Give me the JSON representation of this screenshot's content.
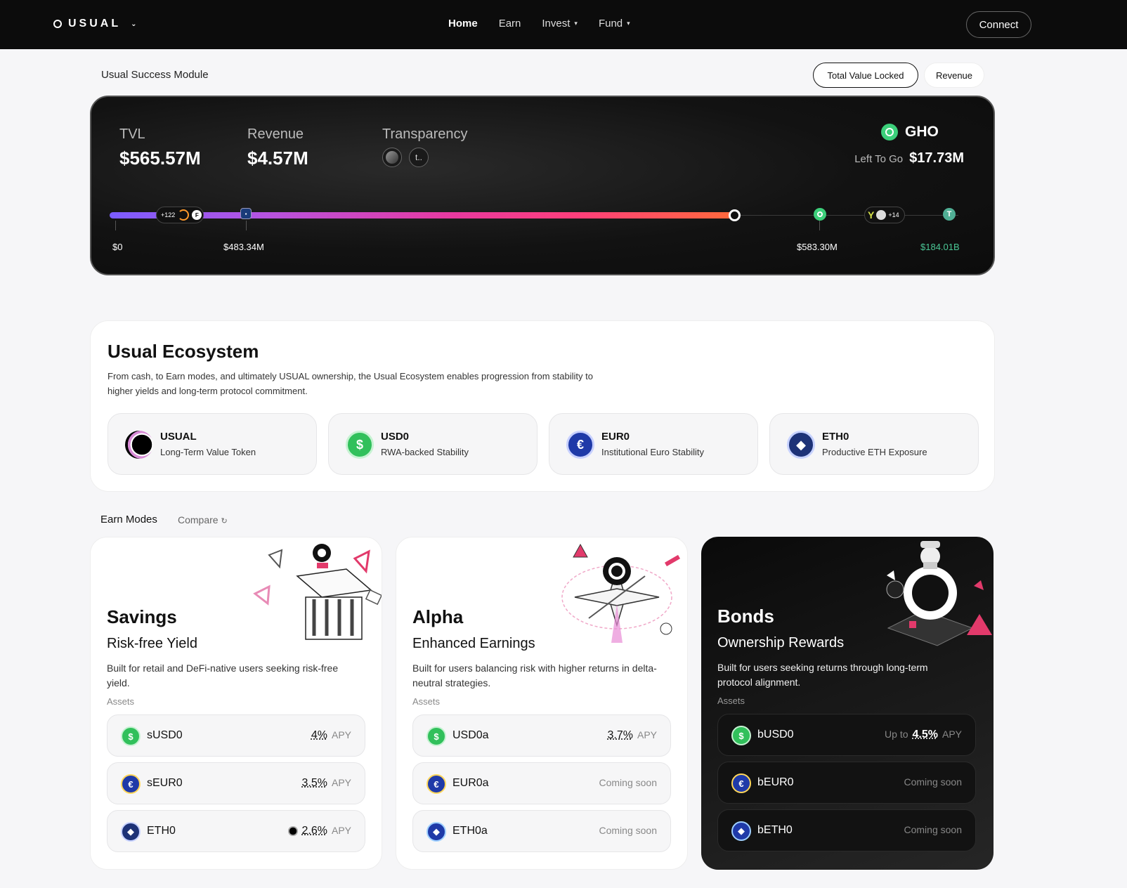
{
  "nav": {
    "brand": "USUAL",
    "links": [
      {
        "label": "Home",
        "active": true
      },
      {
        "label": "Earn"
      },
      {
        "label": "Invest",
        "dropdown": true
      },
      {
        "label": "Fund",
        "dropdown": true
      }
    ],
    "connect_label": "Connect"
  },
  "module": {
    "title": "Usual Success Module",
    "toggle_tvl": "Total Value Locked",
    "toggle_revenue": "Revenue",
    "tvl_label": "TVL",
    "tvl_value": "$565.57M",
    "revenue_label": "Revenue",
    "revenue_value": "$4.57M",
    "transparency_label": "Transparency",
    "transparency_icon_text": "t..",
    "target_name": "GHO",
    "left_to_go_label": "Left To Go",
    "left_to_go_value": "$17.73M",
    "progress": {
      "start_label": "$0",
      "partner_count": "+122",
      "milestone_1": "$483.34M",
      "milestone_2": "$583.30M",
      "more_count": "+14",
      "end_label": "$184.01B",
      "reached_fraction": 0.73
    }
  },
  "ecosystem": {
    "title": "Usual Ecosystem",
    "description": "From cash, to Earn modes, and ultimately USUAL ownership, the Usual Ecosystem enables progression from stability to higher yields and long-term protocol commitment.",
    "tokens": [
      {
        "name": "USUAL",
        "sub": "Long-Term Value Token",
        "icon": "usual-icon"
      },
      {
        "name": "USD0",
        "sub": "RWA-backed Stability",
        "icon": "dollar-icon"
      },
      {
        "name": "EUR0",
        "sub": "Institutional Euro Stability",
        "icon": "euro-icon"
      },
      {
        "name": "ETH0",
        "sub": "Productive ETH Exposure",
        "icon": "eth-icon"
      }
    ]
  },
  "earn": {
    "title": "Earn Modes",
    "compare_label": "Compare",
    "modes": [
      {
        "title": "Savings",
        "subtitle": "Risk-free Yield",
        "desc": "Built for retail and DeFi-native users seeking risk-free yield.",
        "assets_label": "Assets",
        "assets": [
          {
            "name": "sUSD0",
            "pct": "4%",
            "unit": "APY"
          },
          {
            "name": "sEUR0",
            "pct": "3.5%",
            "unit": "APY"
          },
          {
            "name": "ETH0",
            "pct": "2.6%",
            "unit": "APY"
          }
        ]
      },
      {
        "title": "Alpha",
        "subtitle": "Enhanced Earnings",
        "desc": "Built for users balancing risk with higher returns in delta-neutral strategies.",
        "assets_label": "Assets",
        "assets": [
          {
            "name": "USD0a",
            "pct": "3.7%",
            "unit": "APY"
          },
          {
            "name": "EUR0a",
            "status": "Coming soon"
          },
          {
            "name": "ETH0a",
            "status": "Coming soon"
          }
        ]
      },
      {
        "title": "Bonds",
        "subtitle": "Ownership Rewards",
        "desc": "Built for users seeking returns through long-term protocol alignment.",
        "assets_label": "Assets",
        "assets": [
          {
            "name": "bUSD0",
            "prefix": "Up to",
            "pct": "4.5%",
            "unit": "APY"
          },
          {
            "name": "bEUR0",
            "status": "Coming soon"
          },
          {
            "name": "bETH0",
            "status": "Coming soon"
          }
        ]
      }
    ]
  },
  "colors": {
    "gradient_start": "#7b5cff",
    "gradient_mid": "#e8399f",
    "gradient_end": "#ff6a3a",
    "gho_green": "#3ccf7a",
    "usd_green": "#31c05b",
    "euro_blue": "#1f3aa8"
  }
}
